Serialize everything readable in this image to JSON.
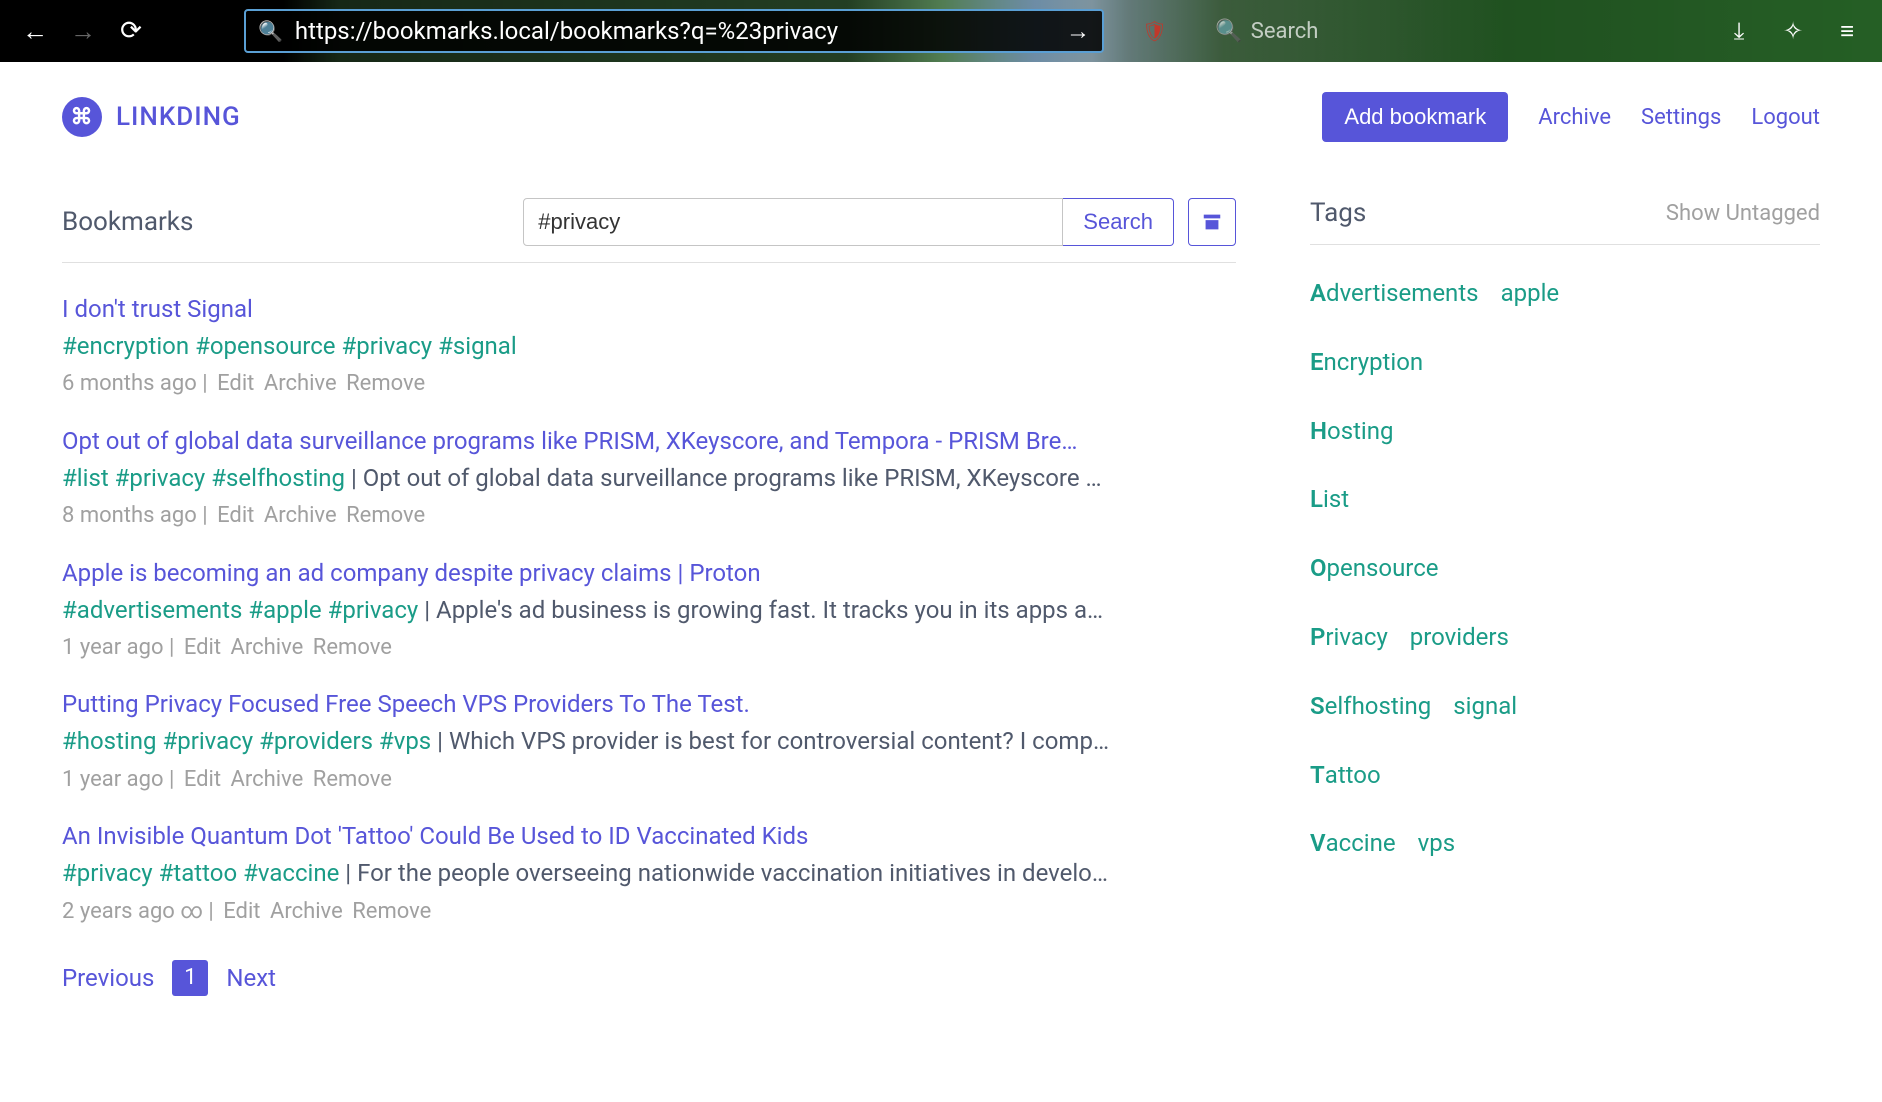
{
  "browser": {
    "url": "https://bookmarks.local/bookmarks?q=%23privacy",
    "search_placeholder": "Search"
  },
  "app": {
    "brand": "LINKDING",
    "nav": {
      "add_bookmark": "Add bookmark",
      "archive": "Archive",
      "settings": "Settings",
      "logout": "Logout"
    }
  },
  "bookmarks_section": {
    "title": "Bookmarks",
    "search_value": "#privacy",
    "search_button": "Search"
  },
  "bookmarks": [
    {
      "title": "I don't trust Signal",
      "tags": [
        "#encryption",
        "#opensource",
        "#privacy",
        "#signal"
      ],
      "description": "",
      "date": "6 months ago",
      "permanent": false
    },
    {
      "title": "Opt out of global data surveillance programs like PRISM, XKeyscore, and Tempora - PRISM Bre…",
      "tags": [
        "#list",
        "#privacy",
        "#selfhosting"
      ],
      "description": "Opt out of global data surveillance programs like PRISM, XKeyscore …",
      "date": "8 months ago",
      "permanent": false
    },
    {
      "title": "Apple is becoming an ad company despite privacy claims | Proton",
      "tags": [
        "#advertisements",
        "#apple",
        "#privacy"
      ],
      "description": "Apple's ad business is growing fast. It tracks you in its apps a…",
      "date": "1 year ago",
      "permanent": false
    },
    {
      "title": "Putting Privacy Focused Free Speech VPS Providers To The Test.",
      "tags": [
        "#hosting",
        "#privacy",
        "#providers",
        "#vps"
      ],
      "description": "Which VPS provider is best for controversial content? I comp…",
      "date": "1 year ago",
      "permanent": false
    },
    {
      "title": "An Invisible Quantum Dot 'Tattoo' Could Be Used to ID Vaccinated Kids",
      "tags": [
        "#privacy",
        "#tattoo",
        "#vaccine"
      ],
      "description": "For the people overseeing nationwide vaccination initiatives in develo…",
      "date": "2 years ago",
      "permanent": true
    }
  ],
  "actions": {
    "edit": "Edit",
    "archive": "Archive",
    "remove": "Remove"
  },
  "pagination": {
    "previous": "Previous",
    "page": "1",
    "next": "Next"
  },
  "tags_section": {
    "title": "Tags",
    "show_untagged": "Show Untagged"
  },
  "tag_cloud": [
    "Advertisements",
    "apple",
    "Encryption",
    "Hosting",
    "List",
    "Opensource",
    "Privacy",
    "providers",
    "Selfhosting",
    "signal",
    "Tattoo",
    "Vaccine",
    "vps"
  ]
}
